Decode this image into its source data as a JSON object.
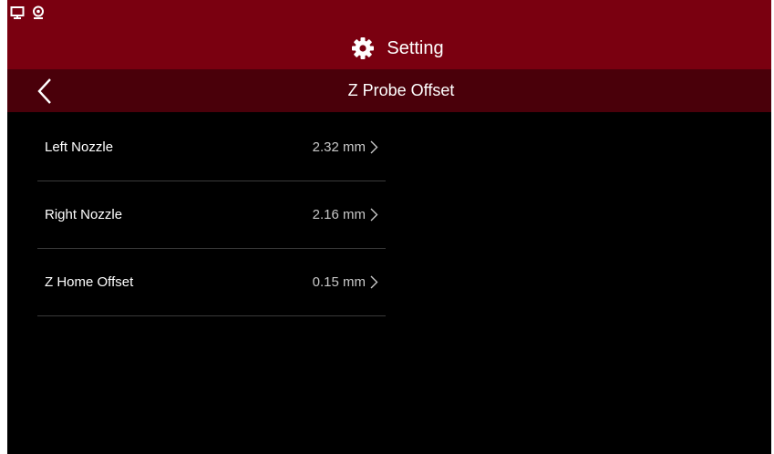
{
  "status_bar": {
    "icons": [
      "monitor-icon",
      "webcam-icon"
    ]
  },
  "header": {
    "icon": "gear-icon",
    "title": "Setting"
  },
  "sub_header": {
    "back_icon": "chevron-left-icon",
    "title": "Z Probe Offset"
  },
  "settings": [
    {
      "label": "Left Nozzle",
      "value": "2.32 mm"
    },
    {
      "label": "Right Nozzle",
      "value": "2.16 mm"
    },
    {
      "label": "Z Home Offset",
      "value": "0.15 mm"
    }
  ],
  "colors": {
    "header_bg": "#7a0010",
    "sub_header_bg": "#4a000a",
    "background": "#000000",
    "divider": "#3a3a3a"
  }
}
